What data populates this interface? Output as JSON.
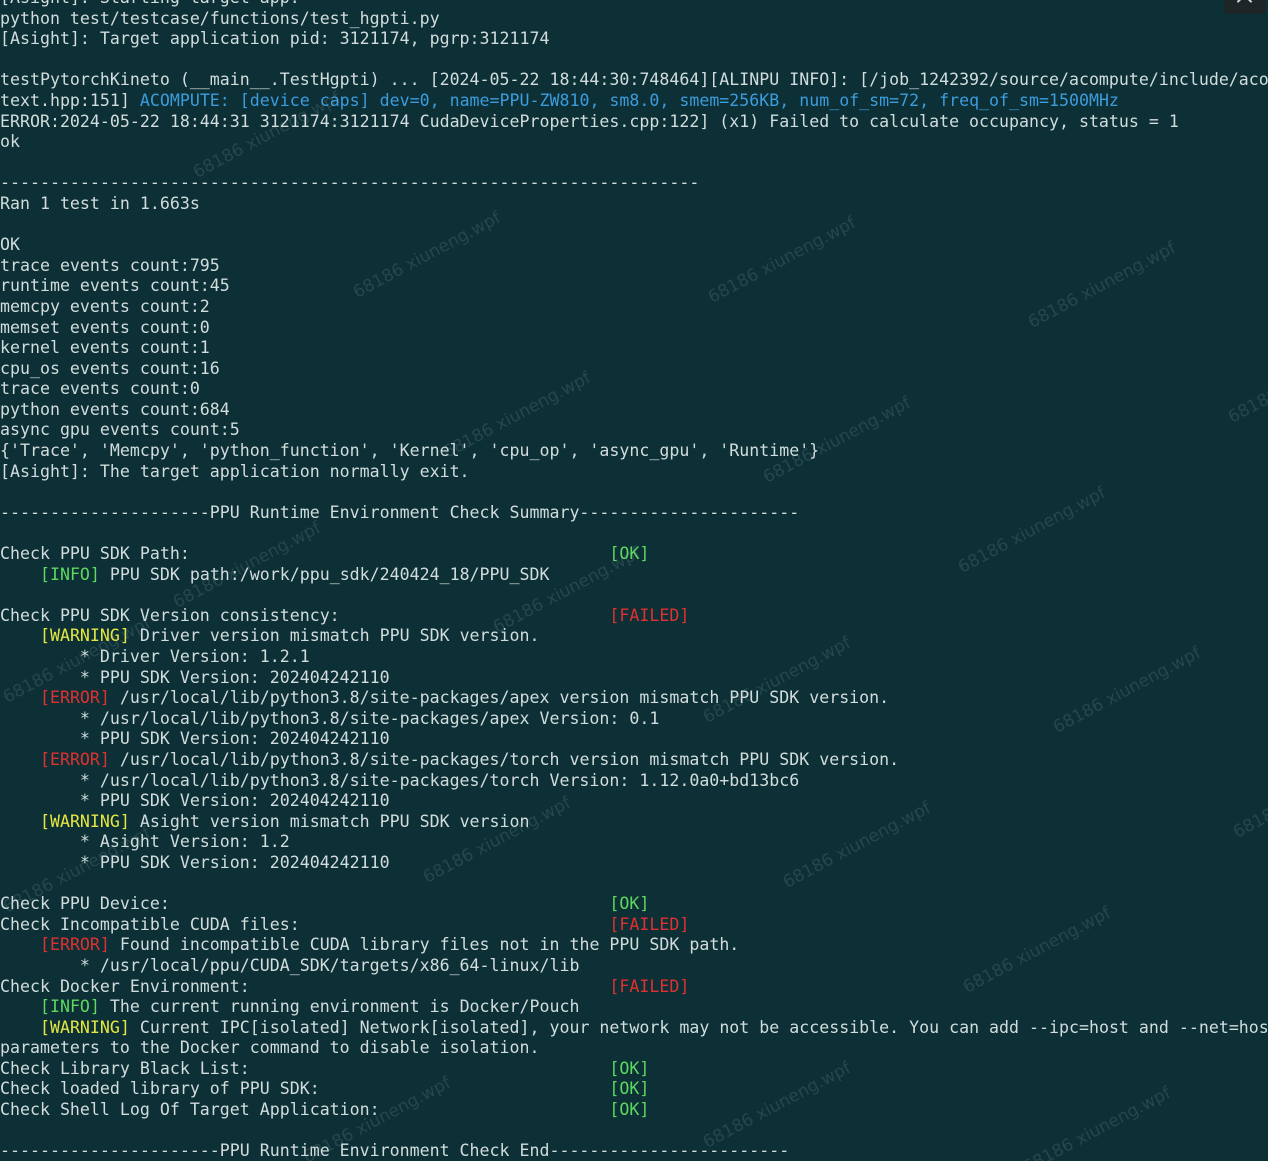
{
  "terminal": {
    "lines": [
      [
        {
          "t": "[Asight]: Starting target app.",
          "c": "normal"
        }
      ],
      [
        {
          "t": "python test/testcase/functions/test_hgpti.py",
          "c": "normal"
        }
      ],
      [
        {
          "t": "[Asight]: Target application pid: 3121174, pgrp:3121174",
          "c": "normal"
        }
      ],
      [
        {
          "t": "",
          "c": "normal"
        }
      ],
      [
        {
          "t": "testPytorchKineto (__main__.TestHgpti) ... [2024-05-22 18:44:30:748464][ALINPU INFO]: [/job_1242392/source/acompute/include/acompute_con",
          "c": "normal"
        }
      ],
      [
        {
          "t": "text.hpp:151] ",
          "c": "normal"
        },
        {
          "t": "ACOMPUTE: [device caps] dev=0, name=PPU-ZW810, sm8.0, smem=256KB, num_of_sm=72, freq_of_sm=1500MHz",
          "c": "blue"
        }
      ],
      [
        {
          "t": "ERROR:2024-05-22 18:44:31 3121174:3121174 CudaDeviceProperties.cpp:122] (x1) Failed to calculate occupancy, status = 1",
          "c": "normal"
        }
      ],
      [
        {
          "t": "ok",
          "c": "normal"
        }
      ],
      [
        {
          "t": "",
          "c": "normal"
        }
      ],
      [
        {
          "t": "----------------------------------------------------------------------",
          "c": "normal"
        }
      ],
      [
        {
          "t": "Ran 1 test in 1.663s",
          "c": "normal"
        }
      ],
      [
        {
          "t": "",
          "c": "normal"
        }
      ],
      [
        {
          "t": "OK",
          "c": "normal"
        }
      ],
      [
        {
          "t": "trace events count:795",
          "c": "normal"
        }
      ],
      [
        {
          "t": "runtime events count:45",
          "c": "normal"
        }
      ],
      [
        {
          "t": "memcpy events count:2",
          "c": "normal"
        }
      ],
      [
        {
          "t": "memset events count:0",
          "c": "normal"
        }
      ],
      [
        {
          "t": "kernel events count:1",
          "c": "normal"
        }
      ],
      [
        {
          "t": "cpu_os events count:16",
          "c": "normal"
        }
      ],
      [
        {
          "t": "trace events count:0",
          "c": "normal"
        }
      ],
      [
        {
          "t": "python events count:684",
          "c": "normal"
        }
      ],
      [
        {
          "t": "async gpu events count:5",
          "c": "normal"
        }
      ],
      [
        {
          "t": "{'Trace', 'Memcpy', 'python_function', 'Kernel', 'cpu_op', 'async_gpu', 'Runtime'}",
          "c": "normal"
        }
      ],
      [
        {
          "t": "[Asight]: The target application normally exit.",
          "c": "normal"
        }
      ],
      [
        {
          "t": "",
          "c": "normal"
        }
      ],
      [
        {
          "t": "---------------------PPU Runtime Environment Check Summary----------------------",
          "c": "normal"
        }
      ],
      [
        {
          "t": "",
          "c": "normal"
        }
      ],
      [
        {
          "t": "Check PPU SDK Path:                                          ",
          "c": "normal"
        },
        {
          "t": "[OK]",
          "c": "ok"
        }
      ],
      [
        {
          "t": "    ",
          "c": "normal"
        },
        {
          "t": "[INFO]",
          "c": "info"
        },
        {
          "t": " PPU SDK path:/work/ppu_sdk/240424_18/PPU_SDK",
          "c": "normal"
        }
      ],
      [
        {
          "t": "",
          "c": "normal"
        }
      ],
      [
        {
          "t": "Check PPU SDK Version consistency:                           ",
          "c": "normal"
        },
        {
          "t": "[FAILED]",
          "c": "failed"
        }
      ],
      [
        {
          "t": "    ",
          "c": "normal"
        },
        {
          "t": "[WARNING]",
          "c": "warning"
        },
        {
          "t": " Driver version mismatch PPU SDK version.",
          "c": "normal"
        }
      ],
      [
        {
          "t": "        * Driver Version: 1.2.1",
          "c": "normal"
        }
      ],
      [
        {
          "t": "        * PPU SDK Version: 202404242110",
          "c": "normal"
        }
      ],
      [
        {
          "t": "    ",
          "c": "normal"
        },
        {
          "t": "[ERROR]",
          "c": "error"
        },
        {
          "t": " /usr/local/lib/python3.8/site-packages/apex version mismatch PPU SDK version.",
          "c": "normal"
        }
      ],
      [
        {
          "t": "        * /usr/local/lib/python3.8/site-packages/apex Version: 0.1",
          "c": "normal"
        }
      ],
      [
        {
          "t": "        * PPU SDK Version: 202404242110",
          "c": "normal"
        }
      ],
      [
        {
          "t": "    ",
          "c": "normal"
        },
        {
          "t": "[ERROR]",
          "c": "error"
        },
        {
          "t": " /usr/local/lib/python3.8/site-packages/torch version mismatch PPU SDK version.",
          "c": "normal"
        }
      ],
      [
        {
          "t": "        * /usr/local/lib/python3.8/site-packages/torch Version: 1.12.0a0+bd13bc6",
          "c": "normal"
        }
      ],
      [
        {
          "t": "        * PPU SDK Version: 202404242110",
          "c": "normal"
        }
      ],
      [
        {
          "t": "    ",
          "c": "normal"
        },
        {
          "t": "[WARNING]",
          "c": "warning"
        },
        {
          "t": " Asight version mismatch PPU SDK version",
          "c": "normal"
        }
      ],
      [
        {
          "t": "        * Asight Version: 1.2",
          "c": "normal"
        }
      ],
      [
        {
          "t": "        * PPU SDK Version: 202404242110",
          "c": "normal"
        }
      ],
      [
        {
          "t": "",
          "c": "normal"
        }
      ],
      [
        {
          "t": "Check PPU Device:                                            ",
          "c": "normal"
        },
        {
          "t": "[OK]",
          "c": "ok"
        }
      ],
      [
        {
          "t": "Check Incompatible CUDA files:                               ",
          "c": "normal"
        },
        {
          "t": "[FAILED]",
          "c": "failed"
        }
      ],
      [
        {
          "t": "    ",
          "c": "normal"
        },
        {
          "t": "[ERROR]",
          "c": "error"
        },
        {
          "t": " Found incompatible CUDA library files not in the PPU SDK path.",
          "c": "normal"
        }
      ],
      [
        {
          "t": "        * /usr/local/ppu/CUDA_SDK/targets/x86_64-linux/lib",
          "c": "normal"
        }
      ],
      [
        {
          "t": "Check Docker Environment:                                    ",
          "c": "normal"
        },
        {
          "t": "[FAILED]",
          "c": "failed"
        }
      ],
      [
        {
          "t": "    ",
          "c": "normal"
        },
        {
          "t": "[INFO]",
          "c": "info"
        },
        {
          "t": " The current running environment is Docker/Pouch",
          "c": "normal"
        }
      ],
      [
        {
          "t": "    ",
          "c": "normal"
        },
        {
          "t": "[WARNING]",
          "c": "warning"
        },
        {
          "t": " Current IPC[isolated] Network[isolated], your network may not be accessible. You can add --ipc=host and --net=host",
          "c": "normal"
        }
      ],
      [
        {
          "t": "parameters to the Docker command to disable isolation.",
          "c": "normal"
        }
      ],
      [
        {
          "t": "Check Library Black List:                                    ",
          "c": "normal"
        },
        {
          "t": "[OK]",
          "c": "ok"
        }
      ],
      [
        {
          "t": "Check loaded library of PPU SDK:                             ",
          "c": "normal"
        },
        {
          "t": "[OK]",
          "c": "ok"
        }
      ],
      [
        {
          "t": "Check Shell Log Of Target Application:                       ",
          "c": "normal"
        },
        {
          "t": "[OK]",
          "c": "ok"
        }
      ],
      [
        {
          "t": "",
          "c": "normal"
        }
      ],
      [
        {
          "t": "----------------------PPU Runtime Environment Check End------------------------",
          "c": "normal"
        }
      ]
    ]
  },
  "watermark": {
    "text": "68186 xiuneng.wpf"
  },
  "icons": {
    "corner_button": "chevron-up-icon"
  },
  "colors": {
    "background": "#0c3036",
    "text": "#d2dcdc",
    "blue": "#3c9cdc",
    "ok": "#5ed85e",
    "failed": "#e03030",
    "warning": "#e6e640"
  }
}
